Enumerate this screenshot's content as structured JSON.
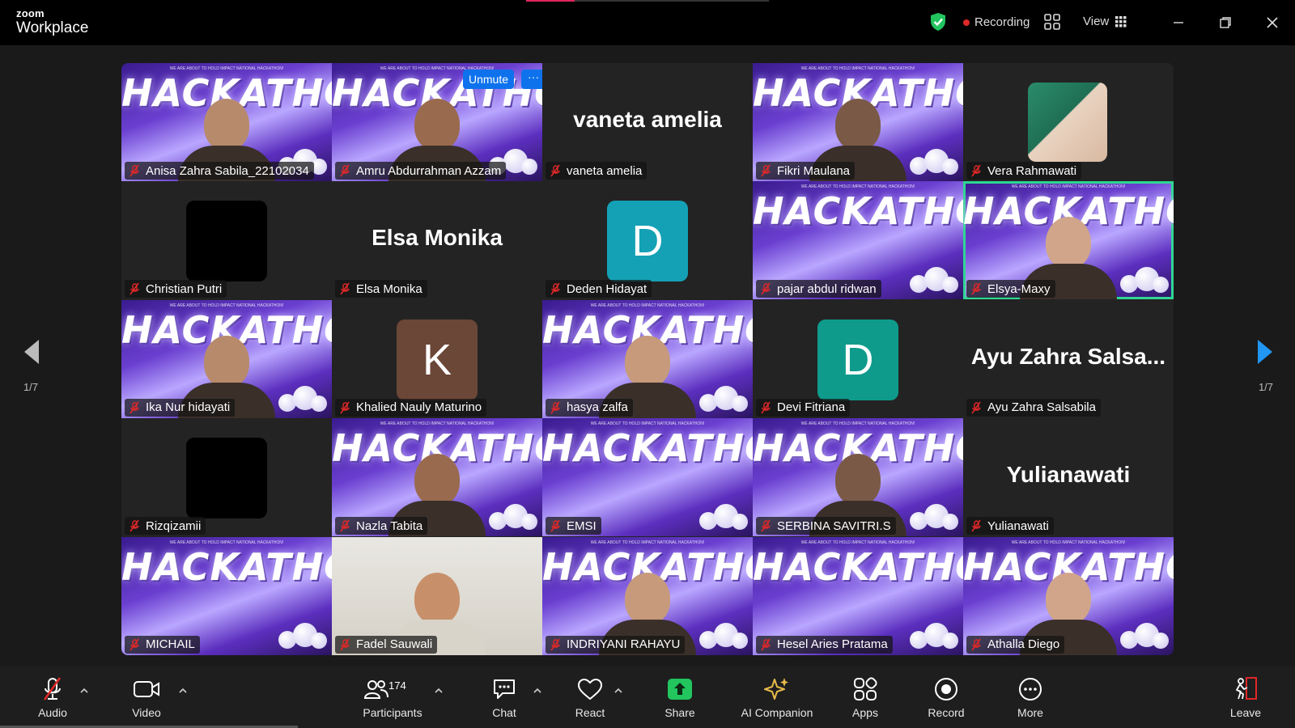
{
  "app": {
    "brand_top": "zoom",
    "brand_bottom": "Workplace"
  },
  "topbar": {
    "recording_label": "Recording",
    "view_label": "View",
    "progress": 0.2
  },
  "pagination": {
    "left_label": "1/7",
    "right_label": "1/7"
  },
  "hackathon_banner": {
    "big": "HACKATHON",
    "small": "WE ARE ABOUT TO HOLD IMPACT NATIONAL HACKATHON!"
  },
  "pinned_controls": {
    "unmute_label": "Unmute",
    "more_label": "···"
  },
  "participants": [
    {
      "name": "Anisa Zahra Sabila_22102034",
      "kind": "hack"
    },
    {
      "name": "Amru Abdurrahman Azzam",
      "kind": "hack"
    },
    {
      "name": "vaneta amelia",
      "kind": "namecard",
      "display": "vaneta amelia"
    },
    {
      "name": "Fikri Maulana",
      "kind": "hack"
    },
    {
      "name": "Vera Rahmawati",
      "kind": "camera"
    },
    {
      "name": "Christian Putri",
      "kind": "blank"
    },
    {
      "name": "Elsa Monika",
      "kind": "namecard",
      "display": "Elsa Monika"
    },
    {
      "name": "Deden Hidayat",
      "kind": "avatar",
      "initial": "D",
      "color": "#14a1b5"
    },
    {
      "name": "pajar abdul ridwan",
      "kind": "hack"
    },
    {
      "name": "Elsya-Maxy",
      "kind": "hack",
      "active_speaker": true
    },
    {
      "name": "Ika Nur hidayati",
      "kind": "hack"
    },
    {
      "name": "Khalied Nauly Maturino",
      "kind": "avatar",
      "initial": "K",
      "color": "#6b4737"
    },
    {
      "name": "hasya zalfa",
      "kind": "hack"
    },
    {
      "name": "Devi Fitriana",
      "kind": "avatar",
      "initial": "D",
      "color": "#0f9b8c"
    },
    {
      "name": "Ayu Zahra Salsabila",
      "kind": "namecard",
      "display": "Ayu Zahra Salsa..."
    },
    {
      "name": "Rizqizamii",
      "kind": "blank"
    },
    {
      "name": "Nazla Tabita",
      "kind": "hack"
    },
    {
      "name": "EMSI",
      "kind": "hack"
    },
    {
      "name": "SERBINA SAVITRI.S",
      "kind": "hack"
    },
    {
      "name": "Yulianawati",
      "kind": "namecard",
      "display": "Yulianawati"
    },
    {
      "name": "MICHAIL",
      "kind": "hack"
    },
    {
      "name": "Fadel Sauwali",
      "kind": "photo"
    },
    {
      "name": "INDRIYANI RAHAYU",
      "kind": "hack"
    },
    {
      "name": "Hesel Aries Pratama",
      "kind": "hack"
    },
    {
      "name": "Athalla Diego",
      "kind": "hack"
    }
  ],
  "toolbar": {
    "audio": "Audio",
    "video": "Video",
    "participants": "Participants",
    "participants_count": "174",
    "chat": "Chat",
    "react": "React",
    "share": "Share",
    "ai_companion": "AI Companion",
    "apps": "Apps",
    "record": "Record",
    "more": "More",
    "leave": "Leave"
  },
  "colors": {
    "accent_blue": "#0e72ed",
    "speaker_outline": "#2fd693",
    "share_green": "#22c55e",
    "mute_red": "#e02828"
  }
}
